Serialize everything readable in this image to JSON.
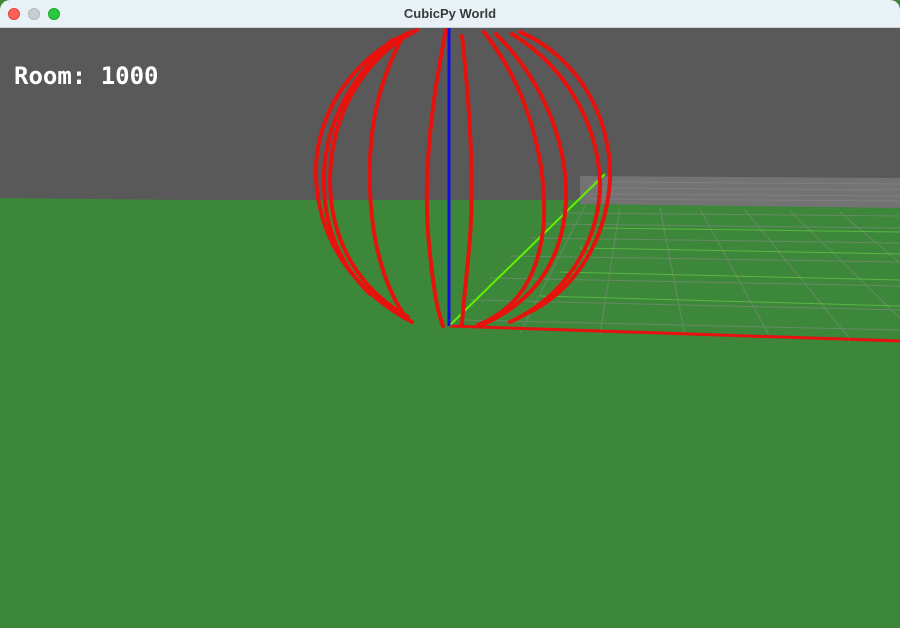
{
  "window": {
    "title": "CubicPy World",
    "buttons": [
      "close-icon",
      "minimize-icon",
      "zoom-icon"
    ]
  },
  "hud": {
    "room_label": "Room: 1000"
  },
  "scene": {
    "sky_color": "#595959",
    "ground_color": "#3d873a",
    "object_color": "#e8120c",
    "axes": {
      "x_color": "#e81010",
      "y_color": "#60f000",
      "z_color": "#1010e0"
    }
  }
}
